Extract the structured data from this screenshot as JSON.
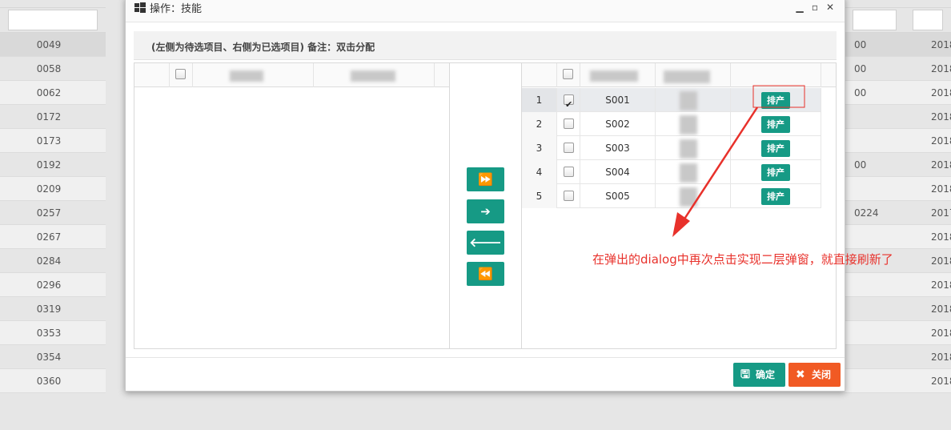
{
  "background": {
    "row_ids": [
      "0049",
      "0058",
      "0062",
      "0172",
      "0173",
      "0192",
      "0209",
      "0257",
      "0267",
      "0284",
      "0296",
      "0319",
      "0353",
      "0354",
      "0360"
    ],
    "mid_values": [
      "00",
      "00",
      "00",
      "",
      "",
      "00",
      "",
      "0224",
      "",
      "",
      "",
      "",
      "",
      "",
      ""
    ],
    "right_values": [
      "2018",
      "2018",
      "2018",
      "2018",
      "2018",
      "2018",
      "2018",
      "2017",
      "2018",
      "2018",
      "2018",
      "2018",
      "2018",
      "2018",
      "2018"
    ]
  },
  "dialog": {
    "title": "操作：技能",
    "note": "(左侧为待选项目、右侧为已选项目) 备注：双击分配",
    "transfer": {
      "move_all_right": "⏩",
      "move_right": "➔",
      "move_left": "🡐",
      "move_all_left": "⏪"
    },
    "right_rows": [
      {
        "num": "1",
        "code": "S001",
        "checked": true,
        "action": "排产"
      },
      {
        "num": "2",
        "code": "S002",
        "checked": false,
        "action": "排产"
      },
      {
        "num": "3",
        "code": "S003",
        "checked": false,
        "action": "排产"
      },
      {
        "num": "4",
        "code": "S004",
        "checked": false,
        "action": "排产"
      },
      {
        "num": "5",
        "code": "S005",
        "checked": false,
        "action": "排产"
      }
    ],
    "footer": {
      "ok_label": "确定",
      "close_label": "关闭"
    }
  },
  "annotation": {
    "text": "在弹出的dialog中再次点击实现二层弹窗，就直接刷新了",
    "color": "#e8312b"
  },
  "colors": {
    "teal": "#169a85",
    "orange": "#f15a24"
  },
  "icons": {
    "title": "windows-icon",
    "ok": "save-icon",
    "close": "close-x-icon"
  }
}
